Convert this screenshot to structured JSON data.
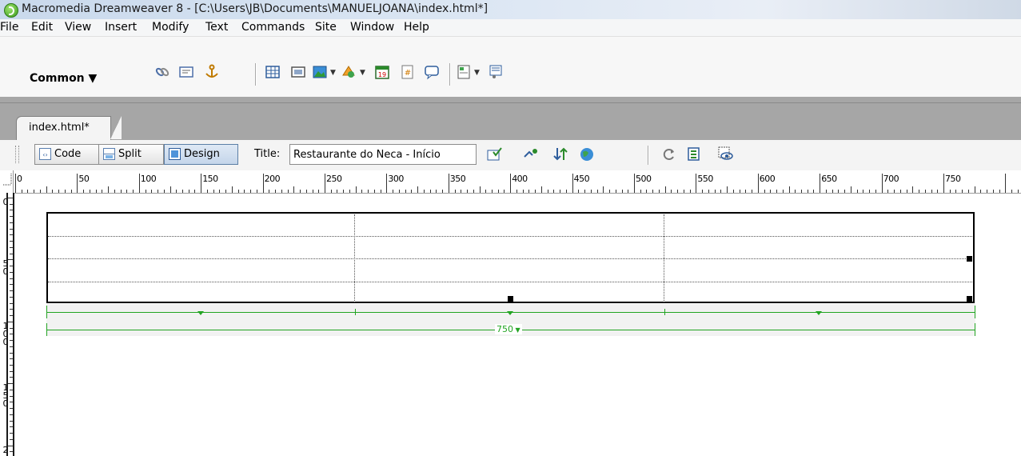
{
  "window": {
    "title": "Macromedia Dreamweaver 8 - [C:\\Users\\JB\\Documents\\MANUELJOANA\\index.html*]",
    "app_icon": "dreamweaver-logo-icon"
  },
  "menubar": {
    "items": [
      "File",
      "Edit",
      "View",
      "Insert",
      "Modify",
      "Text",
      "Commands",
      "Site",
      "Window",
      "Help"
    ]
  },
  "insert_bar": {
    "category": "Common ▼",
    "icons": [
      "hyperlink-icon",
      "email-link-icon",
      "named-anchor-icon",
      "table-icon",
      "layer-icon",
      "images-icon",
      "media-icon",
      "date-icon",
      "comment-icon",
      "templates-icon",
      "tag-chooser-icon"
    ]
  },
  "document": {
    "tab_label": "index.html*",
    "views": {
      "code": "Code",
      "split": "Split",
      "design": "Design",
      "active": "Design"
    },
    "title_label": "Title:",
    "title_value": "Restaurante do Neca - Início",
    "toolbar_icons": [
      "validate-markup-icon",
      "file-management-icon",
      "preview-browser-icon",
      "refresh-icon",
      "view-options-icon",
      "visual-aids-icon",
      "file-transfer-icon"
    ]
  },
  "rulers": {
    "h_labels": [
      "0",
      "50",
      "100",
      "150",
      "200",
      "250",
      "300",
      "350",
      "400",
      "450",
      "500",
      "550",
      "600",
      "650",
      "700",
      "750"
    ],
    "v_labels": [
      "0",
      "5\n0",
      "1\n0\n0",
      "1\n5\n0",
      "2"
    ]
  },
  "table": {
    "width_label": "750",
    "rows": 4,
    "columns": 3
  },
  "colors": {
    "table_width_guides": "#22a422",
    "active_view": "#c4d5ea"
  }
}
